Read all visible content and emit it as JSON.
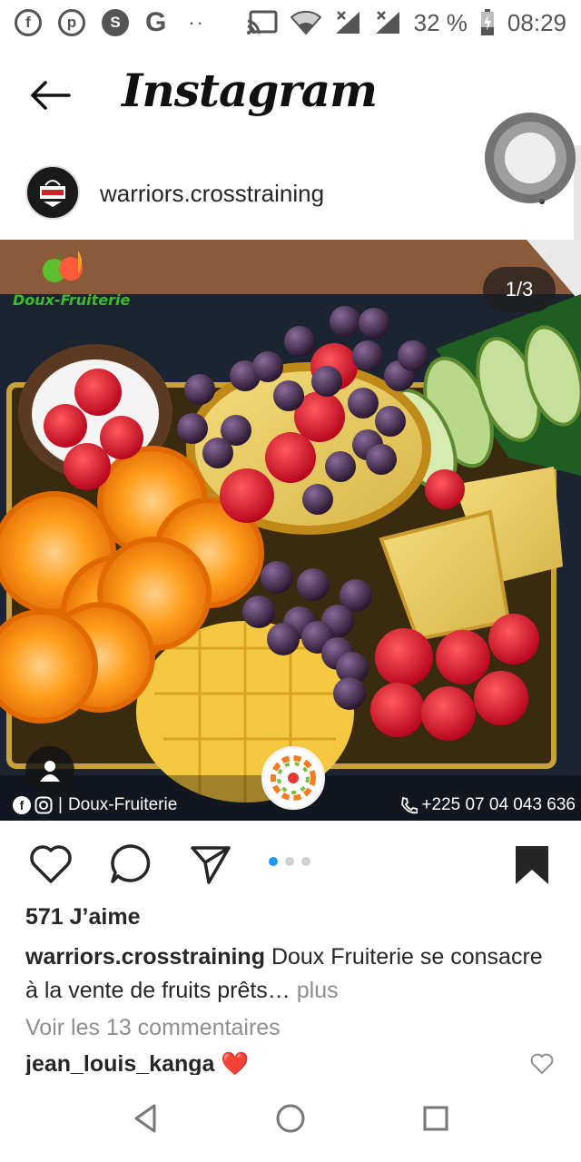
{
  "status_bar": {
    "left_icons": [
      "facebook-icon",
      "pinterest-icon",
      "skype-icon",
      "google-icon",
      "more-notifications-icon"
    ],
    "g_letter": "G",
    "dots": "··",
    "battery_percent": "32 %",
    "time": "08:29"
  },
  "app": {
    "title": "Instagram"
  },
  "post": {
    "username": "warriors.crosstraining",
    "avatar_text": "CROSS TRAINING",
    "image": {
      "counter": "1/3",
      "brand": "Doux-Fruiterie",
      "footer_left": "Doux-Fruiterie",
      "footer_right": "+225 07 04 043 636",
      "center_badge": "Doux-Fruiterie",
      "current_slide": 1,
      "total_slides": 3
    },
    "likes": "571 J’aime",
    "caption_user": "warriors.crosstraining",
    "caption_text": "Doux Fruiterie se consacre à la vente de fruits prêts…",
    "caption_more": "plus",
    "view_comments": "Voir les 13 commentaires",
    "comment_user": "jean_louis_kanga",
    "comment_emoji": "❤️"
  },
  "colors": {
    "accent_blue": "#2196f3",
    "text": "#262626",
    "muted": "#8e8e8e",
    "heart_red": "#e0142a",
    "brand_green": "#3dbb2e"
  }
}
